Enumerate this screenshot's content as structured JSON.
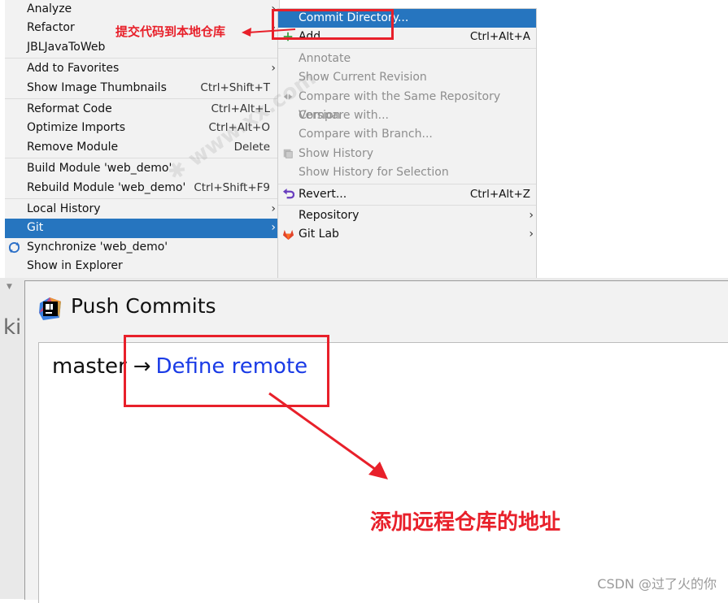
{
  "left_menu": [
    {
      "label": "Analyze",
      "arrow": true
    },
    {
      "label": "Refactor",
      "arrow": true
    },
    {
      "label": "JBLJavaToWeb"
    },
    {
      "sep": true
    },
    {
      "label": "Add to Favorites",
      "arrow": true
    },
    {
      "label": "Show Image Thumbnails",
      "shortcut": "Ctrl+Shift+T"
    },
    {
      "sep": true
    },
    {
      "label": "Reformat Code",
      "shortcut": "Ctrl+Alt+L"
    },
    {
      "label": "Optimize Imports",
      "shortcut": "Ctrl+Alt+O"
    },
    {
      "label": "Remove Module",
      "shortcut": "Delete"
    },
    {
      "sep": true
    },
    {
      "label": "Build Module 'web_demo'"
    },
    {
      "label": "Rebuild Module 'web_demo'",
      "shortcut": "Ctrl+Shift+F9"
    },
    {
      "sep": true
    },
    {
      "label": "Local History",
      "arrow": true
    },
    {
      "label": "Git",
      "arrow": true,
      "selected": true
    },
    {
      "label": "Synchronize 'web_demo'",
      "icon": "sync-icon"
    },
    {
      "label": "Show in Explorer"
    }
  ],
  "git_submenu": [
    {
      "label": "Commit Directory...",
      "selected": true
    },
    {
      "label": "Add",
      "shortcut": "Ctrl+Alt+A",
      "icon": "plus-icon"
    },
    {
      "sep": true
    },
    {
      "label": "Annotate",
      "disabled": true
    },
    {
      "label": "Show Current Revision",
      "disabled": true
    },
    {
      "label": "Compare with the Same Repository Version",
      "disabled": true,
      "icon": "compare-icon"
    },
    {
      "label": "Compare with...",
      "disabled": true
    },
    {
      "label": "Compare with Branch...",
      "disabled": true
    },
    {
      "label": "Show History",
      "disabled": true,
      "icon": "history-icon"
    },
    {
      "label": "Show History for Selection",
      "disabled": true
    },
    {
      "sep": true
    },
    {
      "label": "Revert...",
      "shortcut": "Ctrl+Alt+Z",
      "icon": "revert-icon"
    },
    {
      "sep": true
    },
    {
      "label": "Repository",
      "arrow": true
    },
    {
      "label": "Git Lab",
      "arrow": true,
      "icon": "gitlab-icon"
    }
  ],
  "annotations": {
    "commit_note": "提交代码到本地仓库",
    "remote_note": "添加远程仓库的地址"
  },
  "dialog": {
    "title": "Push Commits",
    "branch": "master",
    "arrow": "→",
    "remote_link": "Define remote"
  },
  "edge_text": "ki",
  "watermark": "CSDN @过了火的你",
  "colors": {
    "selection": "#2675bf",
    "annotation_red": "#e8202a",
    "link_blue": "#1a3be6"
  }
}
